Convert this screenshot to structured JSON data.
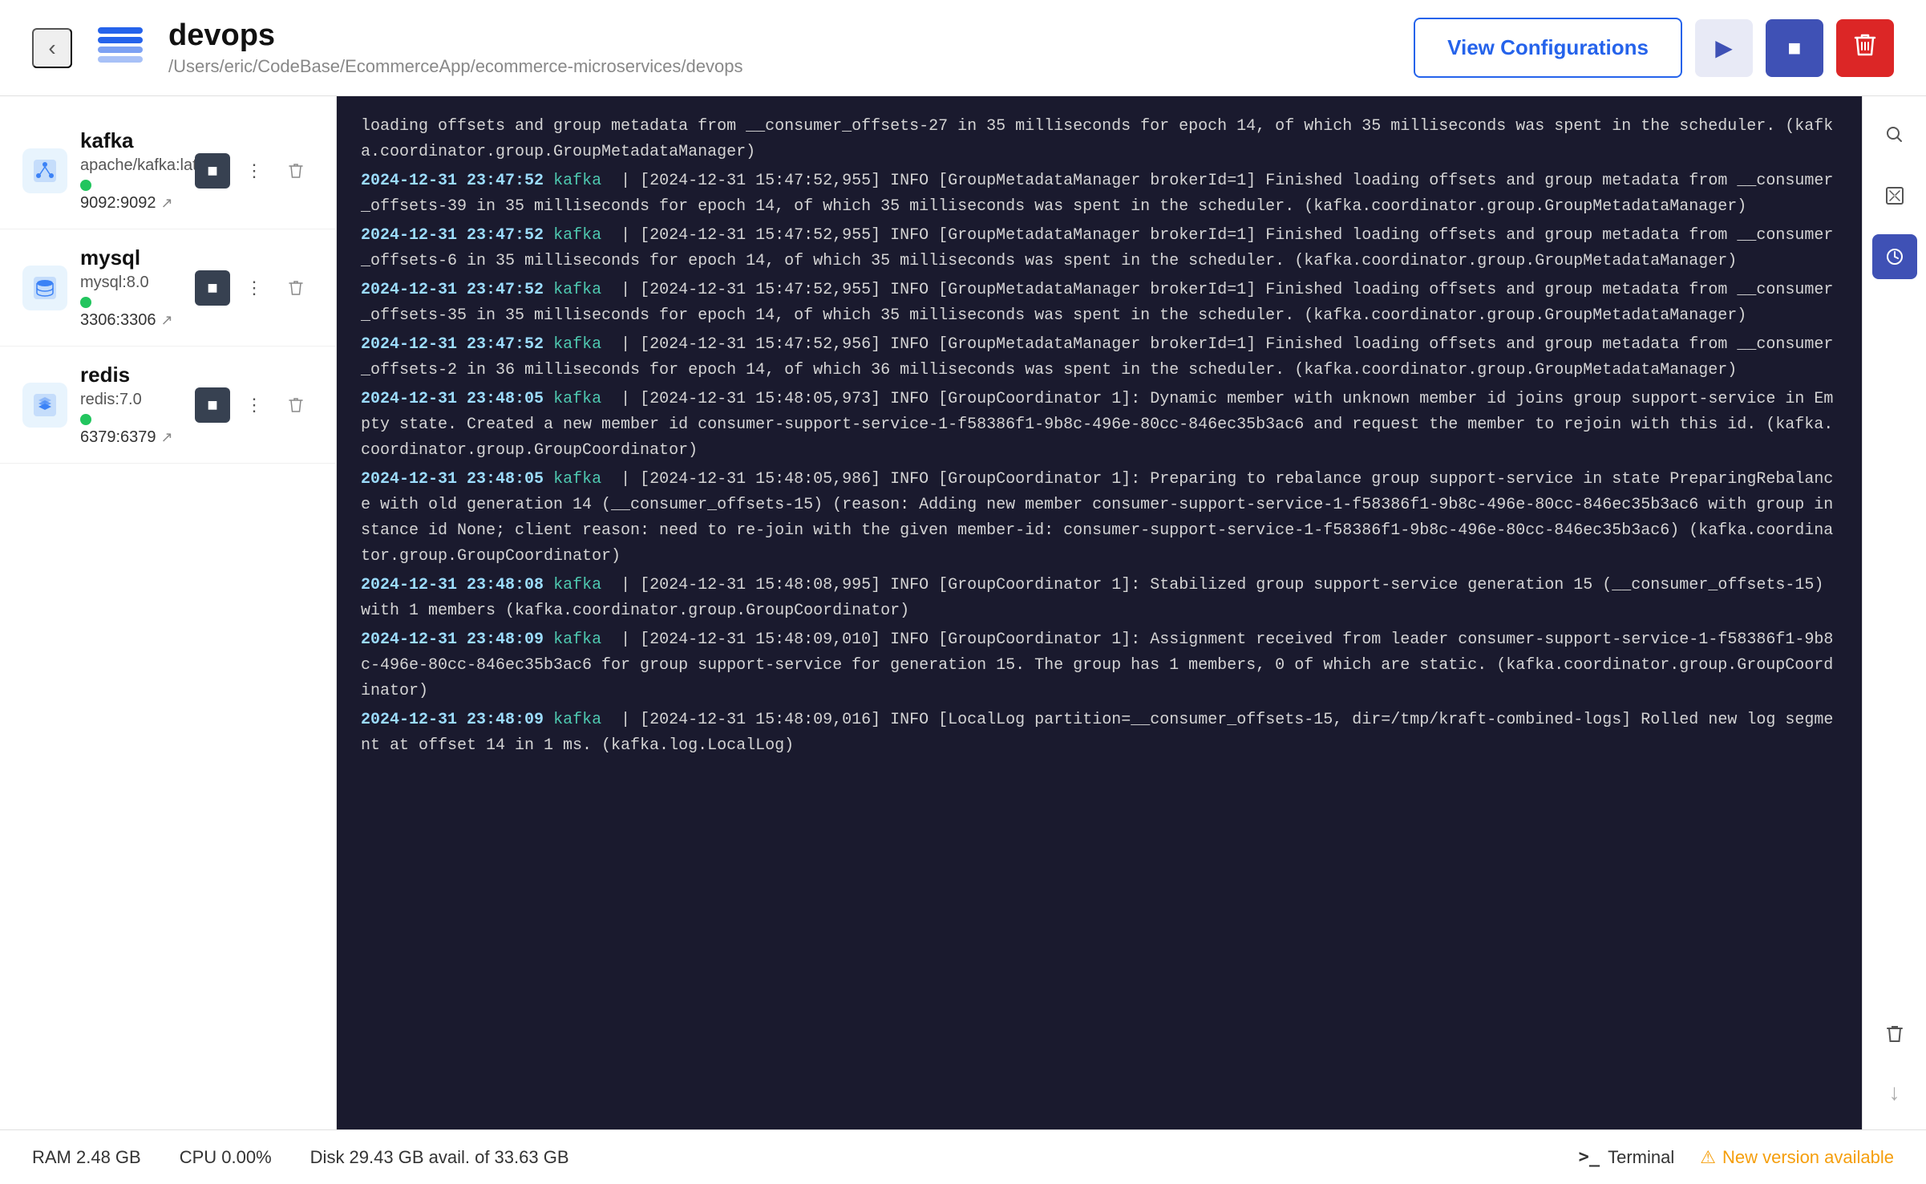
{
  "header": {
    "back_label": "‹",
    "title": "devops",
    "path": "/Users/eric/CodeBase/EcommerceApp/ecommerce-microservices/devops",
    "view_config_label": "View Configurations",
    "play_icon": "▶",
    "stop_icon": "■",
    "delete_icon": "🗑"
  },
  "sidebar": {
    "services": [
      {
        "name": "kafka",
        "image": "apache/kafka:latest",
        "port": "9092:9092",
        "status": "running"
      },
      {
        "name": "mysql",
        "image": "mysql:8.0",
        "port": "3306:3306",
        "status": "running"
      },
      {
        "name": "redis",
        "image": "redis:7.0",
        "port": "6379:6379",
        "status": "running"
      }
    ]
  },
  "logs": [
    {
      "timestamp": "",
      "service": "",
      "message": "loading offsets and group metadata from __consumer_offsets-27 in 35 milliseconds for epoch 14, of which 35 milliseconds was spent in the scheduler. (kafka.coordinator.group.GroupMetadataManager)"
    },
    {
      "timestamp": "2024-12-31 23:47:52",
      "service": "kafka",
      "message": "| [2024-12-31 15:47:52,955] INFO [GroupMetadataManager brokerId=1] Finished loading offsets and group metadata from __consumer_offsets-39 in 35 milliseconds for epoch 14, of which 35 milliseconds was spent in the scheduler. (kafka.coordinator.group.GroupMetadataManager)"
    },
    {
      "timestamp": "2024-12-31 23:47:52",
      "service": "kafka",
      "message": "| [2024-12-31 15:47:52,955] INFO [GroupMetadataManager brokerId=1] Finished loading offsets and group metadata from __consumer_offsets-6 in 35 milliseconds for epoch 14, of which 35 milliseconds was spent in the scheduler. (kafka.coordinator.group.GroupMetadataManager)"
    },
    {
      "timestamp": "2024-12-31 23:47:52",
      "service": "kafka",
      "message": "| [2024-12-31 15:47:52,955] INFO [GroupMetadataManager brokerId=1] Finished loading offsets and group metadata from __consumer_offsets-35 in 35 milliseconds for epoch 14, of which 35 milliseconds was spent in the scheduler. (kafka.coordinator.group.GroupMetadataManager)"
    },
    {
      "timestamp": "2024-12-31 23:47:52",
      "service": "kafka",
      "message": "| [2024-12-31 15:47:52,956] INFO [GroupMetadataManager brokerId=1] Finished loading offsets and group metadata from __consumer_offsets-2 in 36 milliseconds for epoch 14, of which 36 milliseconds was spent in the scheduler. (kafka.coordinator.group.GroupMetadataManager)"
    },
    {
      "timestamp": "2024-12-31 23:48:05",
      "service": "kafka",
      "message": "| [2024-12-31 15:48:05,973] INFO [GroupCoordinator 1]: Dynamic member with unknown member id joins group support-service in Empty state. Created a new member id consumer-support-service-1-f58386f1-9b8c-496e-80cc-846ec35b3ac6 and request the member to rejoin with this id. (kafka.coordinator.group.GroupCoordinator)"
    },
    {
      "timestamp": "2024-12-31 23:48:05",
      "service": "kafka",
      "message": "| [2024-12-31 15:48:05,986] INFO [GroupCoordinator 1]: Preparing to rebalance group support-service in state PreparingRebalance with old generation 14 (__consumer_offsets-15) (reason: Adding new member consumer-support-service-1-f58386f1-9b8c-496e-80cc-846ec35b3ac6 with group instance id None; client reason: need to re-join with the given member-id: consumer-support-service-1-f58386f1-9b8c-496e-80cc-846ec35b3ac6) (kafka.coordinator.group.GroupCoordinator)"
    },
    {
      "timestamp": "2024-12-31 23:48:08",
      "service": "kafka",
      "message": "| [2024-12-31 15:48:08,995] INFO [GroupCoordinator 1]: Stabilized group support-service generation 15 (__consumer_offsets-15) with 1 members (kafka.coordinator.group.GroupCoordinator)"
    },
    {
      "timestamp": "2024-12-31 23:48:09",
      "service": "kafka",
      "message": "| [2024-12-31 15:48:09,010] INFO [GroupCoordinator 1]: Assignment received from leader consumer-support-service-1-f58386f1-9b8c-496e-80cc-846ec35b3ac6 for group support-service for generation 15. The group has 1 members, 0 of which are static. (kafka.coordinator.group.GroupCoordinator)"
    },
    {
      "timestamp": "2024-12-31 23:48:09",
      "service": "kafka",
      "message": "| [2024-12-31 15:48:09,016] INFO [LocalLog partition=__consumer_offsets-15, dir=/tmp/kraft-combined-logs] Rolled new log segment at offset 14 in 1 ms. (kafka.log.LocalLog)"
    }
  ],
  "right_toolbar": {
    "search_icon": "🔍",
    "expand_icon": "⛶",
    "clock_icon": "🕐",
    "trash_icon": "🗑",
    "scroll_down_icon": "↓"
  },
  "statusbar": {
    "ram": "RAM 2.48 GB",
    "cpu": "CPU 0.00%",
    "disk": "Disk 29.43 GB avail. of 33.63 GB",
    "terminal_icon": ">_",
    "terminal_label": "Terminal",
    "new_version_icon": "⚠",
    "new_version_label": "New version available"
  }
}
